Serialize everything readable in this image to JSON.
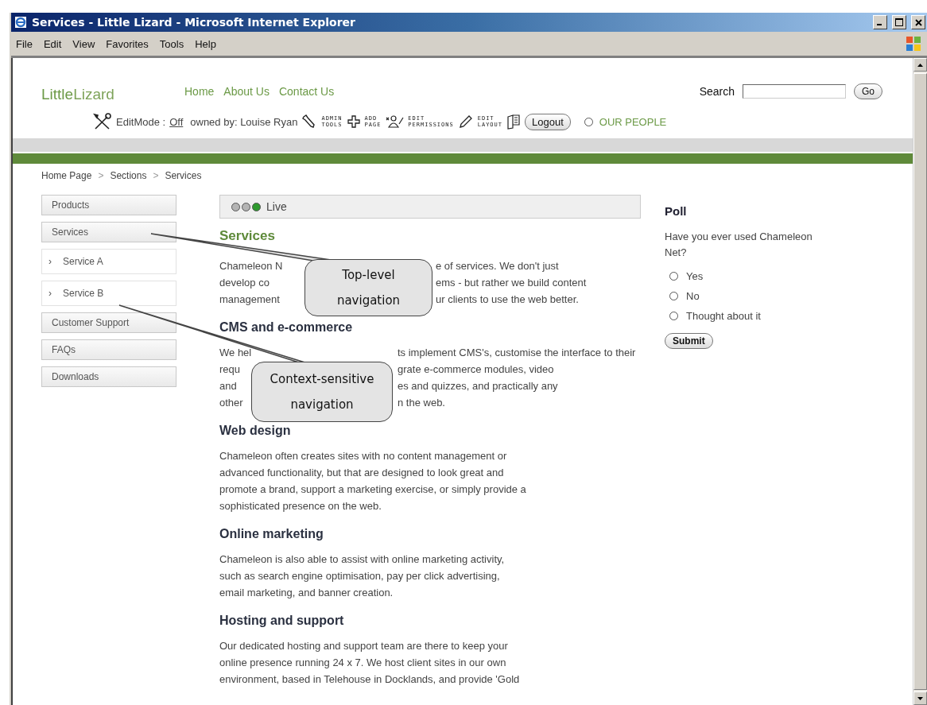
{
  "window": {
    "title": "Services - Little Lizard - Microsoft Internet Explorer"
  },
  "menu": [
    "File",
    "Edit",
    "View",
    "Favorites",
    "Tools",
    "Help"
  ],
  "site": {
    "logo_part_1": "Little",
    "logo_part_2": "Lizard"
  },
  "nav": [
    "Home",
    "About Us",
    "Contact Us"
  ],
  "search": {
    "label": "Search",
    "button": "Go"
  },
  "edit_bar": {
    "mode_label": "EditMode :",
    "mode_value": "Off",
    "owner": "owned by: Louise Ryan",
    "tools": [
      {
        "kind": "wrench",
        "label": "ADMIN TOOLS"
      },
      {
        "kind": "plus",
        "label": "ADD PAGE"
      },
      {
        "kind": "people",
        "label": "EDIT PERMISSIONS"
      },
      {
        "kind": "pencil",
        "label": "EDIT LAYOUT"
      }
    ],
    "logout": "Logout",
    "people_link": {
      "label": "OUR PEOPLE",
      "selected": false
    }
  },
  "breadcrumb": {
    "separator": ">",
    "items": [
      "Home Page",
      "Sections",
      "Services"
    ]
  },
  "sidebar": [
    {
      "kind": "top",
      "label": "Products"
    },
    {
      "kind": "top",
      "label": "Services"
    },
    {
      "kind": "sub",
      "arrow": "›",
      "label": "Service A"
    },
    {
      "kind": "sub",
      "arrow": "›",
      "label": "Service B"
    },
    {
      "kind": "top",
      "label": "Customer Support"
    },
    {
      "kind": "top",
      "label": "FAQs"
    },
    {
      "kind": "top",
      "label": "Downloads"
    }
  ],
  "status": {
    "lights": [
      {
        "color": "#b4b4b4"
      },
      {
        "color": "#b4b4b4"
      },
      {
        "color": "#2e9a2e"
      }
    ],
    "label": "Live"
  },
  "content": {
    "title": "Services",
    "sections": [
      {
        "lines": [
          [
            "Chameleon N",
            "e of services. We don't just"
          ],
          [
            "develop co",
            "ems - but rather we build content"
          ],
          [
            "management",
            "ur clients to use the web better."
          ]
        ]
      },
      {
        "heading": "CMS and e-commerce",
        "lines": [
          [
            "We hel",
            "ts implement CMS's, customise the interface to their"
          ],
          [
            "requ",
            "grate e-commerce modules, video"
          ],
          [
            "and",
            "es and quizzes, and practically any"
          ],
          [
            "other",
            "n the web."
          ]
        ]
      },
      {
        "heading": "Web design",
        "lines": [
          [
            "Chameleon often creates sites with no content management or"
          ],
          [
            "advanced functionality, but that are designed to look great and"
          ],
          [
            "promote a brand, support a marketing exercise, or simply provide a"
          ],
          [
            "sophisticated presence on the web."
          ]
        ]
      },
      {
        "heading": "Online marketing",
        "lines": [
          [
            "Chameleon is also able to assist with online marketing activity,"
          ],
          [
            "such as search engine optimisation, pay per click advertising,"
          ],
          [
            "email marketing, and banner creation."
          ]
        ]
      },
      {
        "heading": "Hosting and support",
        "lines": [
          [
            "Our dedicated hosting and support team are there to keep your"
          ],
          [
            "online presence running 24 x 7. We host client sites in our own"
          ],
          [
            "environment, based in Telehouse in Docklands, and provide 'Gold"
          ]
        ]
      }
    ]
  },
  "poll": {
    "title": "Poll",
    "question": "Have you ever used Chameleon Net?",
    "options": [
      {
        "label": "Yes",
        "selected": false
      },
      {
        "label": "No",
        "selected": false
      },
      {
        "label": "Thought about it",
        "selected": false
      }
    ],
    "button": "Submit"
  },
  "callouts": [
    {
      "lines": [
        "Top-level",
        "navigation"
      ]
    },
    {
      "lines": [
        "Context-sensitive",
        "navigation"
      ]
    }
  ]
}
